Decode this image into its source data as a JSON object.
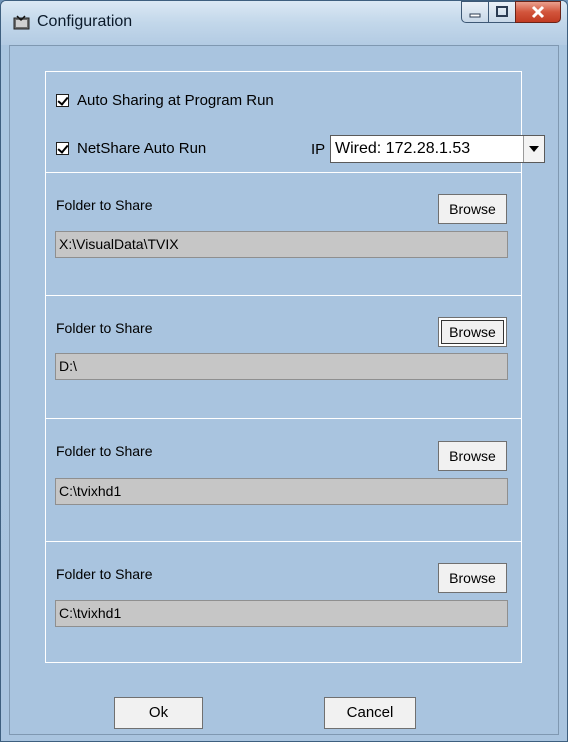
{
  "window": {
    "title": "Configuration"
  },
  "options": {
    "auto_sharing_label": "Auto Sharing at Program Run",
    "auto_sharing_checked": true,
    "netshare_label": "NetShare  Auto Run",
    "netshare_checked": true,
    "ip_label": "IP :",
    "ip_value": "Wired: 172.28.1.53"
  },
  "folders": [
    {
      "label": "Folder to Share",
      "browse_label": "Browse",
      "path": "X:\\VisualData\\TVIX"
    },
    {
      "label": "Folder to Share",
      "browse_label": "Browse",
      "path": "D:\\"
    },
    {
      "label": "Folder to Share",
      "browse_label": "Browse",
      "path": "C:\\tvixhd1"
    },
    {
      "label": "Folder to Share",
      "browse_label": "Browse",
      "path": "C:\\tvixhd1"
    }
  ],
  "buttons": {
    "ok_label": "Ok",
    "cancel_label": "Cancel"
  },
  "icons": {
    "app": "tools-icon",
    "minimize": "minimize-icon",
    "maximize": "maximize-icon",
    "close": "close-icon"
  },
  "colors": {
    "window_bg": "#a9c4df",
    "close_button": "#c13b22",
    "field_bg": "#c6c6c6"
  }
}
